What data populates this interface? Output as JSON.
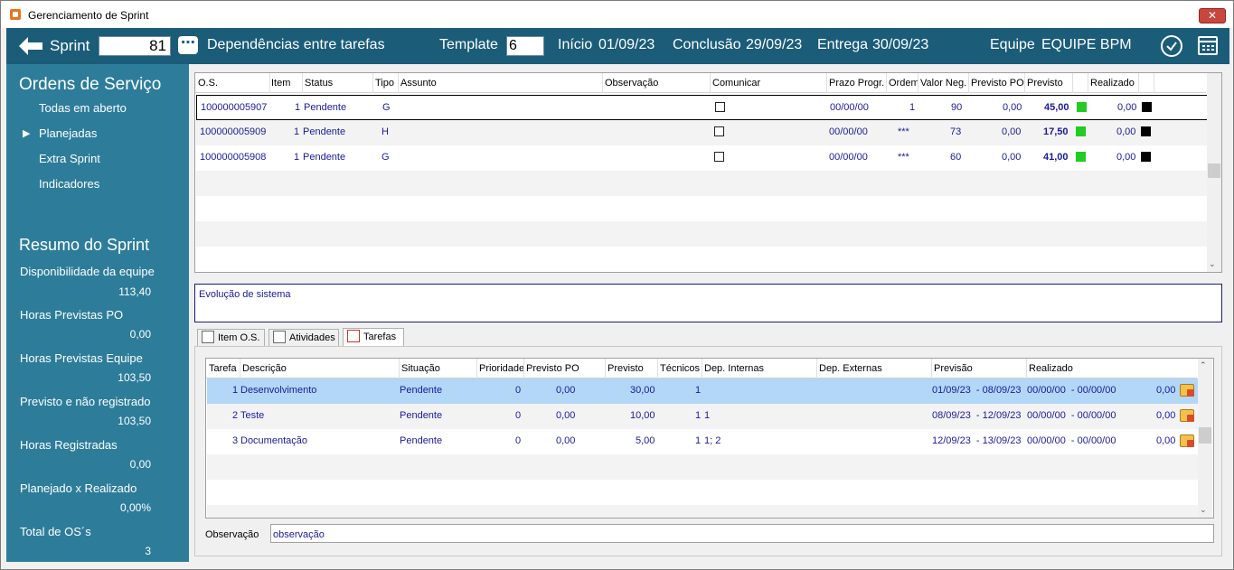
{
  "window": {
    "title": "Gerenciamento de Sprint",
    "close_label": "✕"
  },
  "topbar": {
    "sprint_label": "Sprint",
    "sprint_number": "81",
    "dependencies_label": "Dependências entre tarefas",
    "template_label": "Template",
    "template_value": "6",
    "inicio_label": "Início",
    "inicio_value": "01/09/23",
    "conclusao_label": "Conclusão",
    "conclusao_value": "29/09/23",
    "entrega_label": "Entrega",
    "entrega_value": "30/09/23",
    "equipe_label": "Equipe",
    "equipe_value": "EQUIPE BPM"
  },
  "sidebar": {
    "ordens_title": "Ordens de Serviço",
    "nav": [
      {
        "label": "Todas em aberto"
      },
      {
        "label": "Planejadas",
        "selected": true
      },
      {
        "label": "Extra Sprint"
      },
      {
        "label": "Indicadores"
      }
    ],
    "resumo_title": "Resumo do Sprint",
    "stats": [
      {
        "label": "Disponibilidade da equipe",
        "value": "113,40"
      },
      {
        "label": "Horas Previstas PO",
        "value": "0,00"
      },
      {
        "label": "Horas Previstas Equipe",
        "value": "103,50"
      },
      {
        "label": "Previsto e não registrado",
        "value": "103,50"
      },
      {
        "label": "Horas Registradas",
        "value": "0,00"
      },
      {
        "label": "Planejado x Realizado",
        "value": "0,00%"
      },
      {
        "label": "Total de OS´s",
        "value": "3"
      }
    ]
  },
  "os_grid": {
    "columns": [
      "O.S.",
      "Item",
      "Status",
      "Tipo",
      "Assunto",
      "Observação",
      "Comunicar",
      "Prazo Progr.",
      "Ordem",
      "Valor Neg.",
      "Previsto PO",
      "Previsto",
      "Realizado"
    ],
    "rows": [
      {
        "os": "100000005907",
        "item": "1",
        "status": "Pendente",
        "tipo": "G",
        "prazo": "00/00/00",
        "ordem": "1",
        "valor": "90",
        "previsto_po": "0,00",
        "previsto": "45,00",
        "realizado": "0,00",
        "previsto_color": "#22cc22",
        "realizado_color": "#000000"
      },
      {
        "os": "100000005909",
        "item": "1",
        "status": "Pendente",
        "tipo": "H",
        "prazo": "00/00/00",
        "ordem": "***",
        "valor": "73",
        "previsto_po": "0,00",
        "previsto": "17,50",
        "realizado": "0,00",
        "previsto_color": "#22cc22",
        "realizado_color": "#000000"
      },
      {
        "os": "100000005908",
        "item": "1",
        "status": "Pendente",
        "tipo": "G",
        "prazo": "00/00/00",
        "ordem": "***",
        "valor": "60",
        "previsto_po": "0,00",
        "previsto": "41,00",
        "realizado": "0,00",
        "previsto_color": "#22cc22",
        "realizado_color": "#000000"
      }
    ]
  },
  "description": "Evolução de sistema",
  "tabs": [
    {
      "label": "Item O.S."
    },
    {
      "label": "Atividades"
    },
    {
      "label": "Tarefas",
      "active": true
    }
  ],
  "tasks_grid": {
    "columns": [
      "Tarefa",
      "Descrição",
      "Situação",
      "Prioridade",
      "Previsto PO",
      "Previsto",
      "Técnicos",
      "Dep. Internas",
      "Dep. Externas",
      "Previsão",
      "Realizado"
    ],
    "rows": [
      {
        "tarefa": "1",
        "descricao": "Desenvolvimento",
        "situacao": "Pendente",
        "prioridade": "0",
        "previsto_po": "0,00",
        "previsto": "30,00",
        "tecnicos": "1",
        "dep_internas": "",
        "dep_externas": "",
        "previsao": "01/09/23  - 08/09/23",
        "realizado": "00/00/00  - 00/00/00",
        "horas": "0,00"
      },
      {
        "tarefa": "2",
        "descricao": "Teste",
        "situacao": "Pendente",
        "prioridade": "0",
        "previsto_po": "0,00",
        "previsto": "10,00",
        "tecnicos": "1",
        "dep_internas": "1",
        "dep_externas": "",
        "previsao": "08/09/23  - 12/09/23",
        "realizado": "00/00/00  - 00/00/00",
        "horas": "0,00"
      },
      {
        "tarefa": "3",
        "descricao": "Documentação",
        "situacao": "Pendente",
        "prioridade": "0",
        "previsto_po": "0,00",
        "previsto": "5,00",
        "tecnicos": "1",
        "dep_internas": "1; 2",
        "dep_externas": "",
        "previsao": "12/09/23  - 13/09/23",
        "realizado": "00/00/00  - 00/00/00",
        "horas": "0,00"
      }
    ]
  },
  "observacao": {
    "label": "Observação",
    "value": "observação"
  }
}
